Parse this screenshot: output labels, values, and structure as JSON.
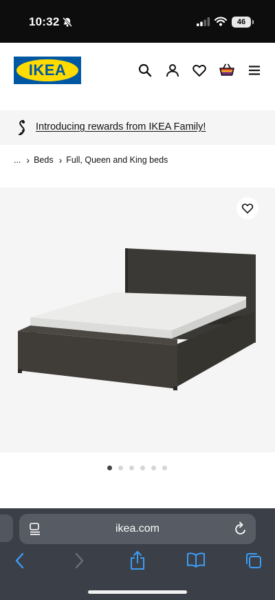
{
  "status_bar": {
    "time": "10:32",
    "battery": "46",
    "icons": [
      "bell-slash-icon",
      "signal-icon",
      "wifi-icon",
      "battery-icon"
    ]
  },
  "header": {
    "logo_text": "IKEA",
    "brand_colors": {
      "blue": "#0058a3",
      "yellow": "#ffdb00"
    },
    "icons": [
      "search-icon",
      "account-icon",
      "heart-icon",
      "shopping-bag-icon",
      "menu-icon"
    ]
  },
  "promo": {
    "text": "Introducing rewards from IKEA Family!",
    "icon": "rewards-icon"
  },
  "breadcrumb": {
    "items": [
      "...",
      "Beds",
      "Full, Queen and King beds"
    ]
  },
  "gallery": {
    "total_images": 6,
    "active_index": 0,
    "favorite_icon": "heart-icon",
    "bed_color": "#3a3834"
  },
  "browser": {
    "url": "ikea.com",
    "icons": [
      "page-menu-icon",
      "reload-icon",
      "back-icon",
      "forward-icon",
      "share-icon",
      "bookmarks-icon",
      "tabs-icon"
    ],
    "forward_enabled": false
  }
}
